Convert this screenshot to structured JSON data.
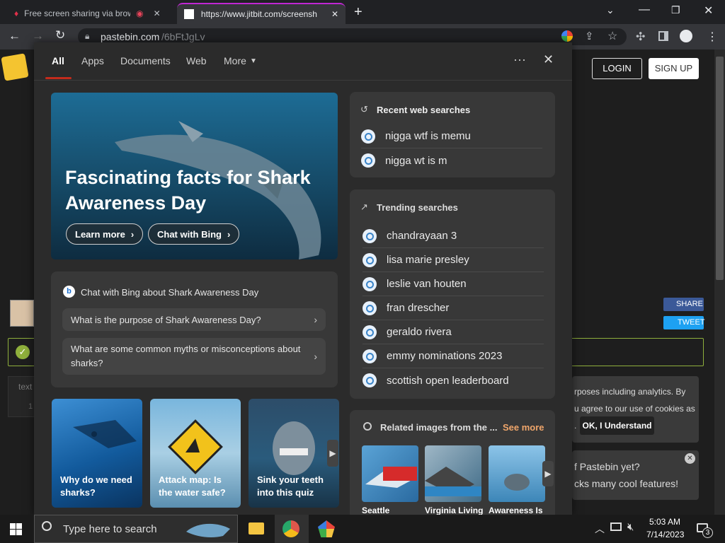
{
  "browser": {
    "tabs": [
      {
        "title": "Free screen sharing via brow"
      },
      {
        "title": "https://www.jitbit.com/screensh"
      }
    ],
    "url_host": "pastebin.com",
    "url_path": "/6bFtJgLv"
  },
  "pastebin": {
    "login": "LOGIN",
    "signup": "SIGN UP",
    "share": "SHARE",
    "tweet": "TWEET",
    "text_label": "text",
    "line_number": "1",
    "cookie_text": [
      "rposes including analytics. By",
      "u agree to our use of cookies as",
      "."
    ],
    "cookie_button": "OK, I Understand",
    "promo_text": [
      "f Pastebin yet?",
      "cks many cool features!"
    ]
  },
  "panel": {
    "tabs": [
      "All",
      "Apps",
      "Documents",
      "Web",
      "More"
    ],
    "hero": {
      "title": "Fascinating facts for Shark Awareness Day",
      "learn_more": "Learn more",
      "chat_bing": "Chat with Bing"
    },
    "chat": {
      "heading": "Chat with Bing about Shark Awareness Day",
      "questions": [
        "What is the purpose of Shark Awareness Day?",
        "What are some common myths or misconceptions about sharks?"
      ]
    },
    "thumbs": [
      "Why do we need sharks?",
      "Attack map: Is the water safe?",
      "Sink your teeth into this quiz"
    ],
    "recent": {
      "heading": "Recent web searches",
      "items": [
        "nigga wtf is memu",
        "nigga wt is m"
      ]
    },
    "trending": {
      "heading": "Trending searches",
      "items": [
        "chandrayaan 3",
        "lisa marie presley",
        "leslie van houten",
        "fran drescher",
        "geraldo rivera",
        "emmy nominations 2023",
        "scottish open leaderboard"
      ]
    },
    "related": {
      "heading": "Related images from the ...",
      "see_more": "See more",
      "captions": [
        "Seattle",
        "Virginia Living",
        "Awareness Is"
      ]
    }
  },
  "taskbar": {
    "search_placeholder": "Type here to search",
    "time": "5:03 AM",
    "date": "7/14/2023",
    "notification_count": "3"
  },
  "colors": {
    "accent_red": "#c42b1c",
    "link_orange": "#f0a66b",
    "tab_accent": "#c026d3"
  }
}
